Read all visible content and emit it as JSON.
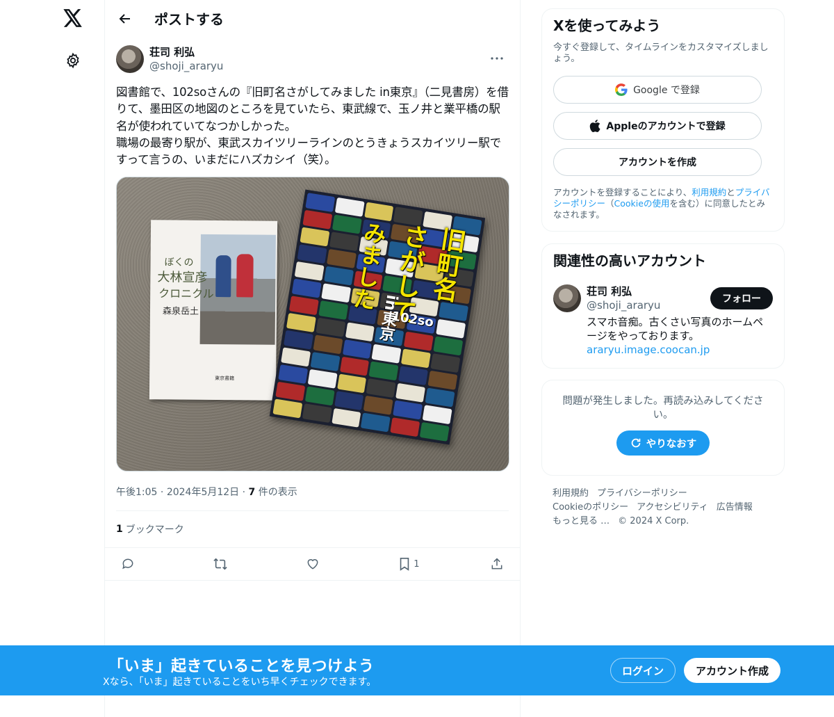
{
  "nav": {
    "logo_icon": "x-logo-icon",
    "settings_icon": "gear-icon"
  },
  "header": {
    "title": "ポストする",
    "back_icon": "arrow-left-icon"
  },
  "post": {
    "display_name": "荘司 利弘",
    "handle": "@shoji_araryu",
    "text": "図書館で、102soさんの『旧町名さがしてみました in東京』（二見書房）を借りて、墨田区の地図のところを見ていたら、東武線で、玉ノ井と業平橋の駅名が使われていてなつかしかった。\n職場の最寄り駅が、東武スカイツリーラインのとうきょうスカイツリー駅ですって言うの、いまだにハズカシイ（笑）。",
    "image": {
      "book1": {
        "line1": "ぼくの",
        "line2": "大林宣彦",
        "line3": "クロニクル",
        "author": "森泉岳土",
        "publisher": "東京書籍"
      },
      "book2": {
        "title_a": "旧町名",
        "title_b": "さがして",
        "title_c": "みました",
        "sub": "in東京",
        "author": "102so"
      }
    },
    "time": "午後1:05",
    "date": "2024年5月12日",
    "views_count": "7",
    "views_label": "件の表示",
    "bookmark_count": "1",
    "bookmark_label": "ブックマーク",
    "action_bookmark_count": "1"
  },
  "signup_card": {
    "title": "Xを使ってみよう",
    "subtitle": "今すぐ登録して、タイムラインをカスタマイズしましょう。",
    "google_label": "Google で登録",
    "apple_label": "Appleのアカウントで登録",
    "create_label": "アカウントを作成",
    "terms_pre": "アカウントを登録することにより、",
    "terms_link1": "利用規約",
    "terms_mid": "と",
    "terms_link2": "プライバシーポリシー",
    "terms_mid2": "（",
    "terms_link3": "Cookieの使用",
    "terms_post": "を含む）に同意したとみなされます。"
  },
  "related": {
    "title": "関連性の高いアカウント",
    "display_name": "荘司 利弘",
    "handle": "@shoji_araryu",
    "follow_label": "フォロー",
    "bio": "スマホ音痴。古くさい写真のホームページをやっております。",
    "bio_link": "araryu.image.coocan.jp"
  },
  "error_card": {
    "message": "問題が発生しました。再読み込みしてください。",
    "retry_label": "やりなおす"
  },
  "footer": {
    "links": [
      "利用規約",
      "プライバシーポリシー",
      "Cookieのポリシー",
      "アクセシビリティ",
      "広告情報",
      "もっと見る …"
    ],
    "copyright": "© 2024 X Corp."
  },
  "banner": {
    "title": "「いま」起きていることを見つけよう",
    "subtitle": "Xなら、「いま」起きていることをいち早くチェックできます。",
    "login_label": "ログイン",
    "signup_label": "アカウント作成"
  },
  "colors": {
    "accent": "#1d9bf0",
    "text": "#0f1419",
    "muted": "#536471"
  }
}
